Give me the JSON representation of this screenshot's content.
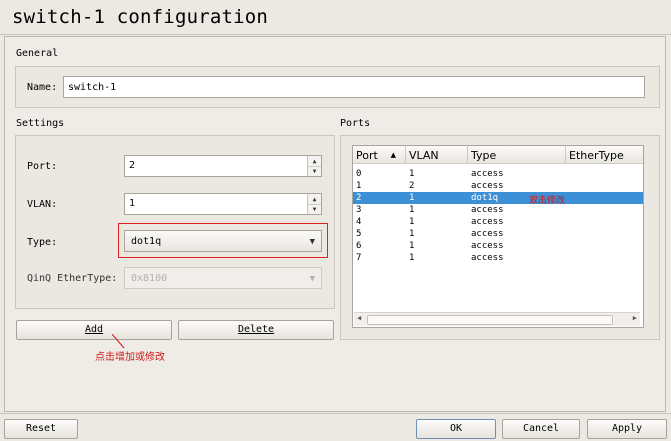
{
  "window": {
    "title": "switch-1 configuration"
  },
  "general": {
    "label": "General",
    "name_label": "Name:",
    "name_value": "switch-1"
  },
  "settings": {
    "label": "Settings",
    "port_label": "Port:",
    "port_value": "2",
    "vlan_label": "VLAN:",
    "vlan_value": "1",
    "type_label": "Type:",
    "type_value": "dot1q",
    "qinq_label": "QinQ EtherType:",
    "qinq_value": "0x8100",
    "add_button": "Add",
    "delete_button": "Delete",
    "annotation": "点击增加或修改"
  },
  "ports": {
    "label": "Ports",
    "columns": [
      "Port",
      "VLAN",
      "Type",
      "EtherType"
    ],
    "rows": [
      {
        "port": "0",
        "vlan": "1",
        "type": "access",
        "ethertype": ""
      },
      {
        "port": "1",
        "vlan": "2",
        "type": "access",
        "ethertype": ""
      },
      {
        "port": "2",
        "vlan": "1",
        "type": "dot1q",
        "ethertype": "",
        "note": "双击修改",
        "selected": true
      },
      {
        "port": "3",
        "vlan": "1",
        "type": "access",
        "ethertype": ""
      },
      {
        "port": "4",
        "vlan": "1",
        "type": "access",
        "ethertype": ""
      },
      {
        "port": "5",
        "vlan": "1",
        "type": "access",
        "ethertype": ""
      },
      {
        "port": "6",
        "vlan": "1",
        "type": "access",
        "ethertype": ""
      },
      {
        "port": "7",
        "vlan": "1",
        "type": "access",
        "ethertype": ""
      }
    ]
  },
  "footer": {
    "reset": "Reset",
    "ok": "OK",
    "cancel": "Cancel",
    "apply": "Apply"
  },
  "colors": {
    "selection": "#3d8fd6",
    "annotation": "#d01818"
  }
}
